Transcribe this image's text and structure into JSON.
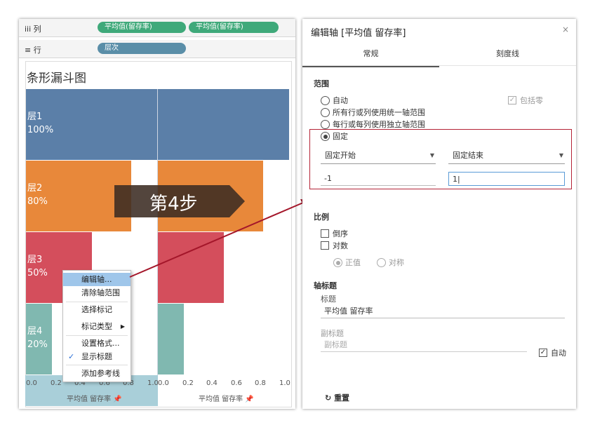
{
  "shelves": {
    "columns_label": "列",
    "rows_label": "行",
    "column_pills": [
      "平均值(留存率)",
      "平均值(留存率)"
    ],
    "row_pill": "层次"
  },
  "viz": {
    "title": "条形漏斗图",
    "levels": [
      {
        "name": "层1",
        "pct": "100%",
        "value": 1.0,
        "color": "#5b7fa8"
      },
      {
        "name": "层2",
        "pct": "80%",
        "value": 0.8,
        "color": "#e8883a"
      },
      {
        "name": "层3",
        "pct": "50%",
        "value": 0.5,
        "color": "#d44e5c"
      },
      {
        "name": "层4",
        "pct": "20%",
        "value": 0.2,
        "color": "#80b8b0"
      }
    ],
    "ticks": [
      "0.0",
      "0.2",
      "0.4",
      "0.6",
      "0.8",
      "1.0"
    ],
    "axis_title": "平均值 留存率"
  },
  "step_label": "第4步",
  "context_menu": {
    "items": [
      "编辑轴...",
      "清除轴范围",
      "选择标记",
      "标记类型",
      "设置格式...",
      "显示标题",
      "添加参考线"
    ]
  },
  "dialog": {
    "title": "编辑轴 [平均值 留存率]",
    "close": "×",
    "tabs": [
      "常规",
      "刻度线"
    ],
    "range": {
      "heading": "范围",
      "options": [
        "自动",
        "所有行或列使用统一轴范围",
        "每行或每列使用独立轴范围",
        "固定"
      ],
      "include_zero": "包括零",
      "fixed_start_label": "固定开始",
      "fixed_end_label": "固定结束",
      "fixed_start_value": "-1",
      "fixed_end_value": "1"
    },
    "scale": {
      "heading": "比例",
      "reversed": "倒序",
      "log": "对数",
      "positive": "正值",
      "symmetric": "对称"
    },
    "axis_title": {
      "heading": "轴标题",
      "title_label": "标题",
      "title_value": "平均值 留存率",
      "subtitle_label": "副标题",
      "subtitle_placeholder": "副标题",
      "auto": "自动"
    },
    "reset": "重置"
  }
}
